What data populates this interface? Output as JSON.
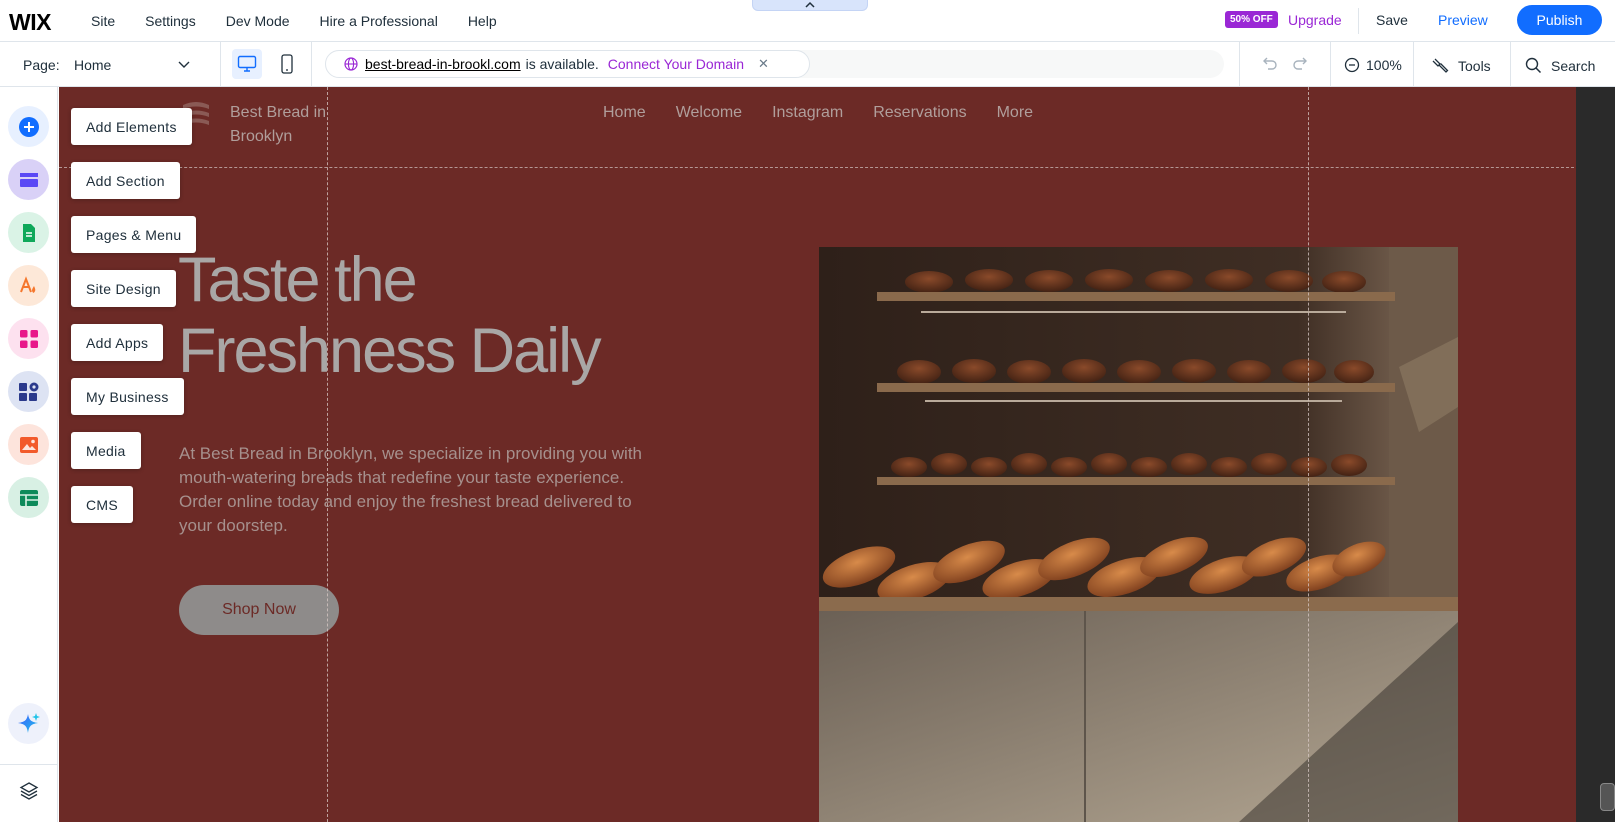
{
  "app": {
    "logo": "WIX",
    "menu": [
      "Site",
      "Settings",
      "Dev Mode",
      "Hire a Professional",
      "Help"
    ],
    "promo_badge": "50% OFF",
    "upgrade_label": "Upgrade",
    "save_label": "Save",
    "preview_label": "Preview",
    "publish_label": "Publish",
    "accent_color": "#116dff",
    "upgrade_color": "#9a27d5"
  },
  "toolbar": {
    "page_label": "Page:",
    "page_value": "Home",
    "domain_url": "best-bread-in-brookl.com",
    "domain_status": "is available.",
    "connect_label": "Connect Your Domain",
    "zoom": "100%",
    "tools_label": "Tools",
    "search_label": "Search"
  },
  "rail": {
    "items": [
      {
        "icon": "plus-circle-icon",
        "label": "Add Elements"
      },
      {
        "icon": "sections-icon",
        "label": "Add Section"
      },
      {
        "icon": "pages-icon",
        "label": "Pages & Menu"
      },
      {
        "icon": "design-icon",
        "label": "Site Design"
      },
      {
        "icon": "apps-icon",
        "label": "Add Apps"
      },
      {
        "icon": "business-icon",
        "label": "My Business"
      },
      {
        "icon": "media-icon",
        "label": "Media"
      },
      {
        "icon": "cms-icon",
        "label": "CMS"
      }
    ],
    "ai_icon": "ai-sparkle-icon",
    "layers_icon": "layers-icon"
  },
  "site": {
    "name": "Best Bread in Brooklyn",
    "nav": [
      "Home",
      "Welcome",
      "Instagram",
      "Reservations",
      "More"
    ],
    "hero_title_line1": "Taste the",
    "hero_title_line2": "Freshness Daily",
    "hero_body": "At Best Bread in Brooklyn, we specialize in providing you with mouth-watering breads that redefine your taste experience. Order online today and enjoy the freshest bread delivered to your doorstep.",
    "cta_label": "Shop Now",
    "background_color": "#6c2a26"
  }
}
